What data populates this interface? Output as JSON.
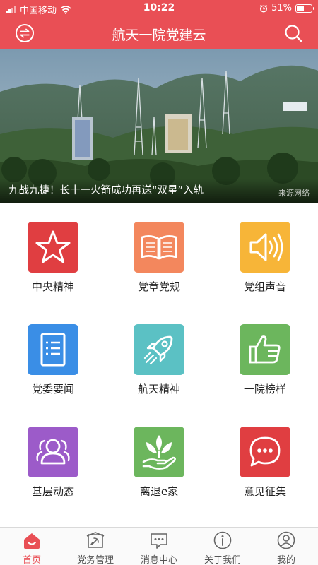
{
  "status_bar": {
    "carrier": "中国移动",
    "time": "10:22",
    "battery": "51%",
    "battery_level": 0.51,
    "icons": [
      "signal-icon",
      "wifi-icon",
      "alarm-icon",
      "battery-icon"
    ]
  },
  "header": {
    "title": "航天一院党建云",
    "left_icon": "switch-icon",
    "right_icon": "search-icon",
    "background": "#e94f55"
  },
  "banner": {
    "caption": "九战九捷！长十一火箭成功再送“双星”入轨",
    "source": "来源网络"
  },
  "grid": {
    "items": [
      {
        "label": "中央精神",
        "icon": "star-icon",
        "color": "#e03e41"
      },
      {
        "label": "党章党规",
        "icon": "book-icon",
        "color": "#f3875d"
      },
      {
        "label": "党组声音",
        "icon": "speaker-icon",
        "color": "#f7b538"
      },
      {
        "label": "党委要闻",
        "icon": "document-icon",
        "color": "#3a8ee6"
      },
      {
        "label": "航天精神",
        "icon": "rocket-icon",
        "color": "#5bc1c4"
      },
      {
        "label": "一院榜样",
        "icon": "thumbs-up-icon",
        "color": "#6cb65d"
      },
      {
        "label": "基层动态",
        "icon": "people-icon",
        "color": "#9c5bc9"
      },
      {
        "label": "离退e家",
        "icon": "leaf-hand-icon",
        "color": "#6cb65d"
      },
      {
        "label": "意见征集",
        "icon": "chat-bubble-icon",
        "color": "#e03e41"
      }
    ]
  },
  "tabbar": {
    "active_color": "#e94f55",
    "items": [
      {
        "label": "首页",
        "icon": "home-icon",
        "active": true
      },
      {
        "label": "党务管理",
        "icon": "party-flag-icon",
        "active": false
      },
      {
        "label": "消息中心",
        "icon": "message-icon",
        "active": false
      },
      {
        "label": "关于我们",
        "icon": "info-icon",
        "active": false
      },
      {
        "label": "我的",
        "icon": "user-icon",
        "active": false
      }
    ]
  }
}
